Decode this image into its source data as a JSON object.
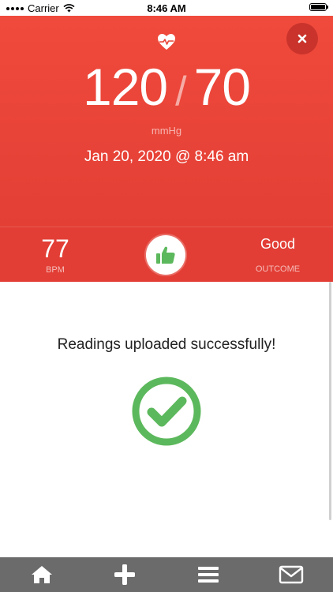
{
  "status_bar": {
    "carrier": "Carrier",
    "time": "8:46 AM"
  },
  "reading": {
    "systolic": "120",
    "separator": "/",
    "diastolic": "70",
    "units": "mmHg",
    "datetime": "Jan 20, 2020 @ 8:46 am"
  },
  "stats": {
    "bpm_value": "77",
    "bpm_label": "BPM",
    "outcome_value": "Good",
    "outcome_label": "OUTCOME"
  },
  "message": "Readings uploaded successfully!",
  "icons": {
    "header": "heart-pulse-icon",
    "close": "close-icon",
    "thumb": "thumbs-up-icon",
    "success": "check-circle-icon",
    "tabs": [
      "home-icon",
      "plus-icon",
      "menu-icon",
      "mail-icon"
    ]
  },
  "colors": {
    "accent_red": "#e23e35",
    "success_green": "#5cb85c",
    "tabbar": "#6b6b6b"
  }
}
